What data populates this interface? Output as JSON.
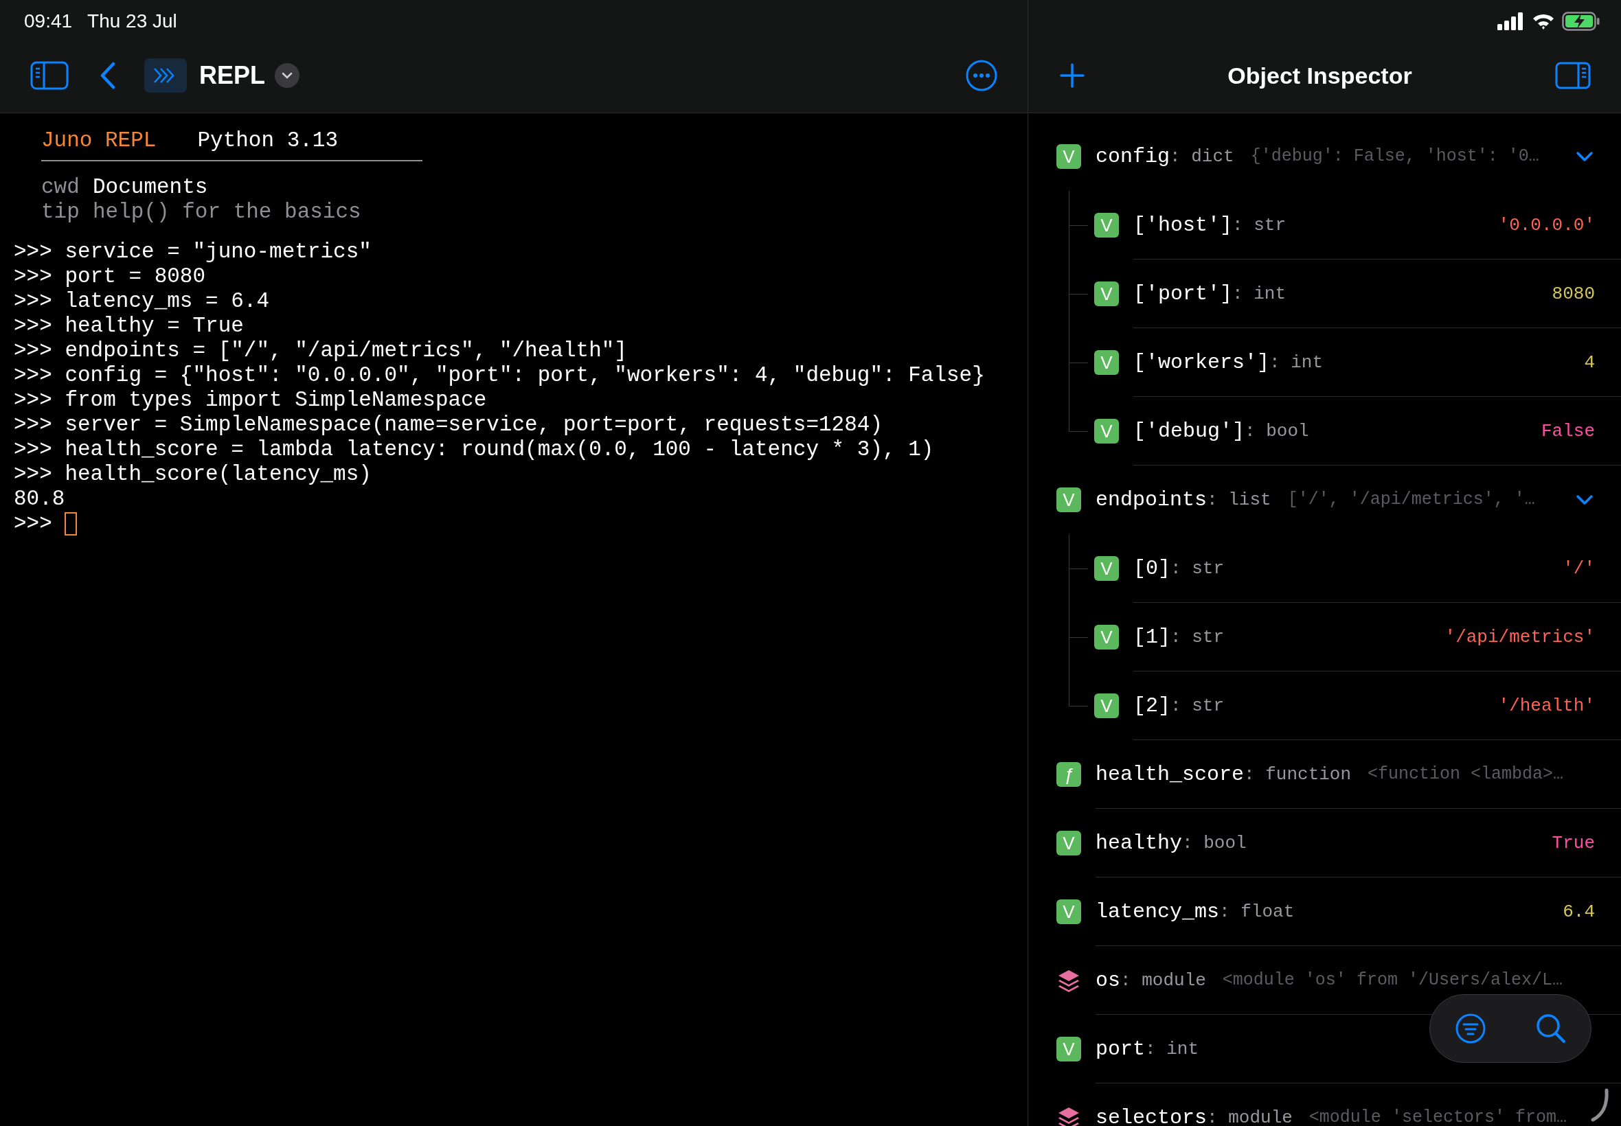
{
  "status_bar": {
    "time": "09:41",
    "date": "Thu 23 Jul"
  },
  "repl_toolbar": {
    "title": "REPL"
  },
  "repl": {
    "banner": {
      "app": "Juno REPL",
      "version": "Python 3.13"
    },
    "info": [
      {
        "key": "cwd",
        "value": "Documents",
        "kind": "path"
      },
      {
        "key": "tip",
        "value": "help() for the basics",
        "kind": "hint"
      }
    ],
    "lines": [
      ">>> service = \"juno-metrics\"",
      ">>> port = 8080",
      ">>> latency_ms = 6.4",
      ">>> healthy = True",
      ">>> endpoints = [\"/\", \"/api/metrics\", \"/health\"]",
      ">>> config = {\"host\": \"0.0.0.0\", \"port\": port, \"workers\": 4, \"debug\": False}",
      ">>> from types import SimpleNamespace",
      ">>> server = SimpleNamespace(name=service, port=port, requests=1284)",
      ">>> health_score = lambda latency: round(max(0.0, 100 - latency * 3), 1)",
      ">>> health_score(latency_ms)",
      "80.8"
    ],
    "prompt": ">>>"
  },
  "inspector": {
    "title": "Object Inspector",
    "items": [
      {
        "kind": "variable",
        "badge": "V",
        "name": "config",
        "type": ": dict",
        "preview": "{'debug': False, 'host': '0…",
        "expanded": true,
        "children": [
          {
            "kind": "variable",
            "badge": "V",
            "name": "['host']",
            "type": ": str",
            "value": "'0.0.0.0'",
            "color": "#ff6353"
          },
          {
            "kind": "variable",
            "badge": "V",
            "name": "['port']",
            "type": ": int",
            "value": "8080",
            "color": "#d6c65a"
          },
          {
            "kind": "variable",
            "badge": "V",
            "name": "['workers']",
            "type": ": int",
            "value": "4",
            "color": "#d6c65a"
          },
          {
            "kind": "variable",
            "badge": "V",
            "name": "['debug']",
            "type": ": bool",
            "value": "False",
            "color": "#ff4fa3"
          }
        ]
      },
      {
        "kind": "variable",
        "badge": "V",
        "name": "endpoints",
        "type": ": list",
        "preview": "['/', '/api/metrics', '…",
        "expanded": true,
        "children": [
          {
            "kind": "variable",
            "badge": "V",
            "name": "[0]",
            "type": ": str",
            "value": "'/'",
            "color": "#ff6353"
          },
          {
            "kind": "variable",
            "badge": "V",
            "name": "[1]",
            "type": ": str",
            "value": "'/api/metrics'",
            "color": "#ff6353"
          },
          {
            "kind": "variable",
            "badge": "V",
            "name": "[2]",
            "type": ": str",
            "value": "'/health'",
            "color": "#ff6353"
          }
        ]
      },
      {
        "kind": "function",
        "badge": "ƒ",
        "name": "health_score",
        "type": ": function",
        "preview": "<function <lambda>…"
      },
      {
        "kind": "variable",
        "badge": "V",
        "name": "healthy",
        "type": ": bool",
        "value": "True",
        "color": "#ff4fa3"
      },
      {
        "kind": "variable",
        "badge": "V",
        "name": "latency_ms",
        "type": ": float",
        "value": "6.4",
        "color": "#d6c65a"
      },
      {
        "kind": "module",
        "name": "os",
        "type": ": module",
        "preview": "<module 'os' from '/Users/alex/L…"
      },
      {
        "kind": "variable",
        "badge": "V",
        "name": "port",
        "type": ": int"
      },
      {
        "kind": "module",
        "name": "selectors",
        "type": ": module",
        "preview": "<module 'selectors' from…"
      }
    ]
  }
}
